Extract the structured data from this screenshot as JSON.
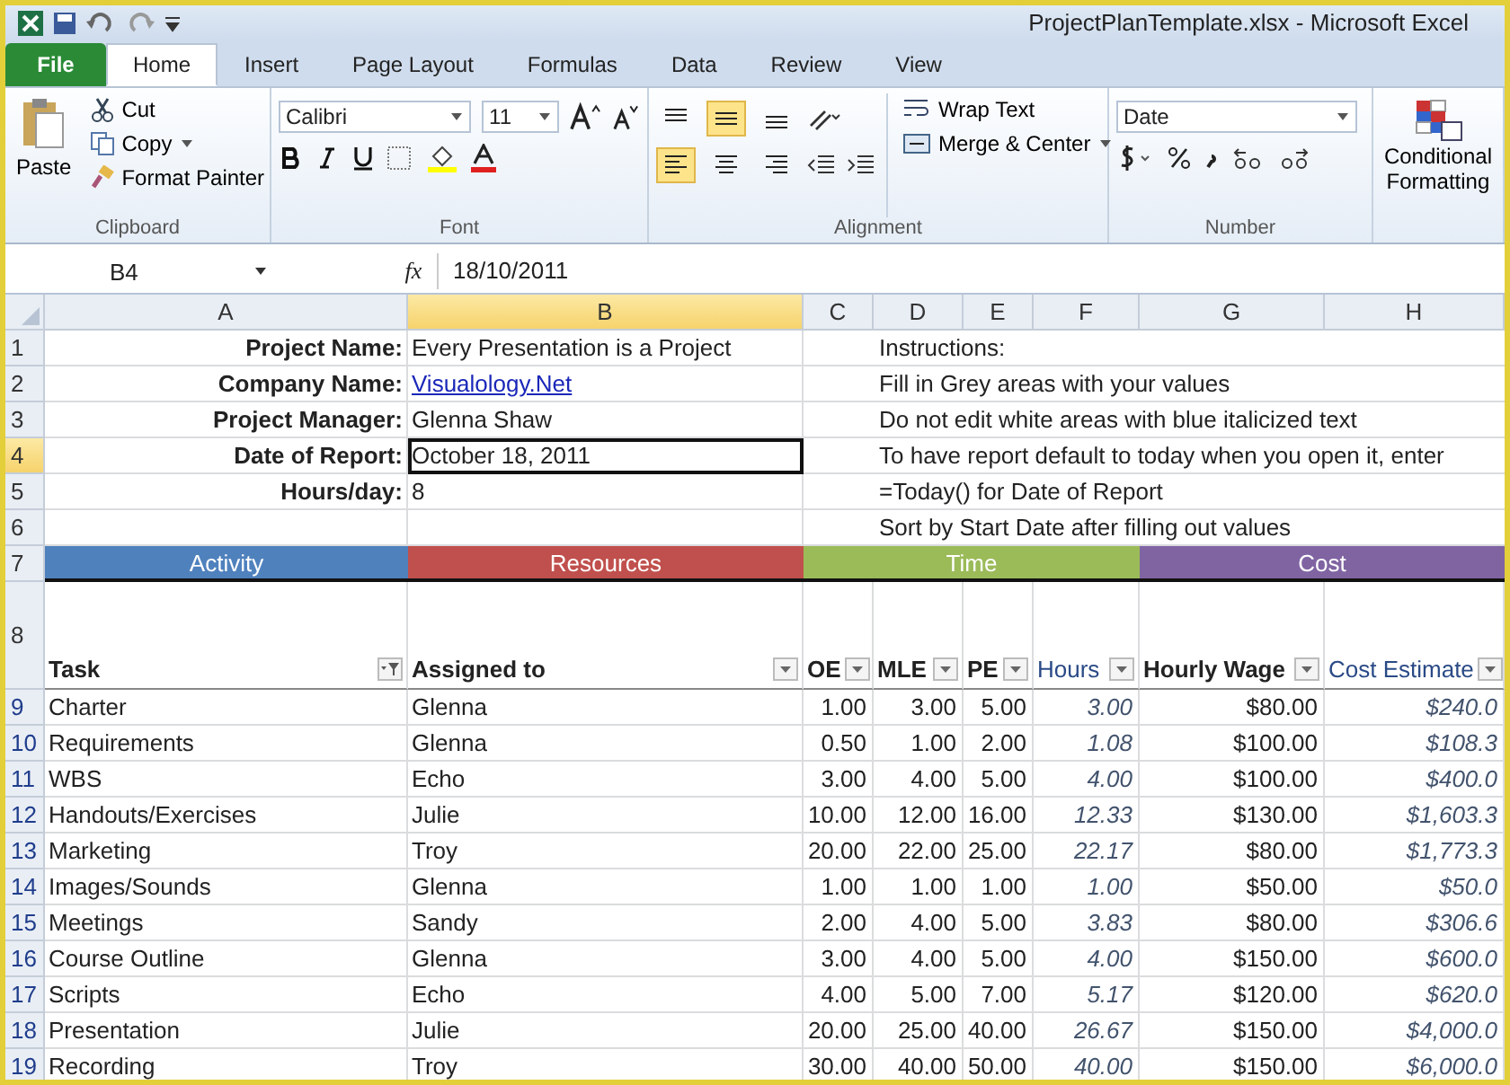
{
  "window": {
    "title": "ProjectPlanTemplate.xlsx  -  Microsoft Excel"
  },
  "tabs": [
    {
      "label": "File",
      "kind": "file",
      "selected": false
    },
    {
      "label": "Home",
      "kind": "tab",
      "selected": true
    },
    {
      "label": "Insert",
      "kind": "tab",
      "selected": false
    },
    {
      "label": "Page Layout",
      "kind": "tab",
      "selected": false
    },
    {
      "label": "Formulas",
      "kind": "tab",
      "selected": false
    },
    {
      "label": "Data",
      "kind": "tab",
      "selected": false
    },
    {
      "label": "Review",
      "kind": "tab",
      "selected": false
    },
    {
      "label": "View",
      "kind": "tab",
      "selected": false
    }
  ],
  "ribbon": {
    "clipboard": {
      "paste": "Paste",
      "cut": "Cut",
      "copy": "Copy",
      "format_painter": "Format Painter",
      "label": "Clipboard"
    },
    "font": {
      "name": "Calibri",
      "size": "11",
      "label": "Font"
    },
    "alignment": {
      "vertical": [
        {
          "kind": "top",
          "selected": false
        },
        {
          "kind": "middle",
          "selected": true
        },
        {
          "kind": "bottom",
          "selected": false
        }
      ],
      "horizontal": [
        {
          "kind": "left",
          "selected": true
        },
        {
          "kind": "center",
          "selected": false
        },
        {
          "kind": "right",
          "selected": false
        }
      ],
      "wrap_text": "Wrap Text",
      "merge_center": "Merge & Center",
      "label": "Alignment"
    },
    "number": {
      "format": "Date",
      "label": "Number"
    },
    "conditional_formatting": "Conditional Formatting"
  },
  "formula_bar": {
    "name_box": "B4",
    "function_label": "fx",
    "formula": "18/10/2011"
  },
  "columns": [
    {
      "label": "A",
      "selected": false
    },
    {
      "label": "B",
      "selected": true
    },
    {
      "label": "C",
      "selected": false
    },
    {
      "label": "D",
      "selected": false
    },
    {
      "label": "E",
      "selected": false
    },
    {
      "label": "F",
      "selected": false
    },
    {
      "label": "G",
      "selected": false
    },
    {
      "label": "H",
      "selected": false
    }
  ],
  "info_rows": [
    {
      "row": "1",
      "label": "Project Name:",
      "value": "Every Presentation is a Project",
      "kind": "text",
      "selected": false
    },
    {
      "row": "2",
      "label": "Company Name:",
      "value": "Visualology.Net",
      "kind": "link",
      "selected": false
    },
    {
      "row": "3",
      "label": "Project Manager:",
      "value": "Glenna Shaw",
      "kind": "text",
      "selected": false
    },
    {
      "row": "4",
      "label": "Date of Report:",
      "value": "October 18, 2011",
      "kind": "text",
      "selected": true
    },
    {
      "row": "5",
      "label": "Hours/day:",
      "value": "8",
      "kind": "text",
      "selected": false
    }
  ],
  "blank_row": "6",
  "instructions": [
    "Instructions:",
    "Fill in Grey areas with your values",
    "Do not edit white areas with blue italicized text",
    "To have report default to today when you open it, enter",
    "=Today() for Date of Report",
    "Sort by Start Date after filling out values"
  ],
  "band_row": "7",
  "bands": [
    {
      "label": "Activity",
      "color": "#4f81bd"
    },
    {
      "label": "Resources",
      "color": "#c0504d"
    },
    {
      "label": "Time",
      "color": "#9bbb59"
    },
    {
      "label": "Cost",
      "color": "#8064a2"
    }
  ],
  "header_row": "8",
  "table_columns": [
    {
      "label": "Task",
      "computed": false,
      "filtered": true
    },
    {
      "label": "Assigned to",
      "computed": false,
      "filtered": false
    },
    {
      "label": "OE",
      "computed": false,
      "filtered": false
    },
    {
      "label": "MLE",
      "computed": false,
      "filtered": false
    },
    {
      "label": "PE",
      "computed": false,
      "filtered": false
    },
    {
      "label": "Hours",
      "computed": true,
      "filtered": false
    },
    {
      "label": "Hourly Wage",
      "computed": false,
      "filtered": false
    },
    {
      "label": "Cost Estimate",
      "computed": true,
      "filtered": false
    }
  ],
  "rows": [
    {
      "row": "9",
      "cells": [
        "Charter",
        "Glenna",
        "1.00",
        "3.00",
        "5.00",
        "3.00",
        "$80.00",
        "$240.0"
      ]
    },
    {
      "row": "10",
      "cells": [
        "Requirements",
        "Glenna",
        "0.50",
        "1.00",
        "2.00",
        "1.08",
        "$100.00",
        "$108.3"
      ]
    },
    {
      "row": "11",
      "cells": [
        "WBS",
        "Echo",
        "3.00",
        "4.00",
        "5.00",
        "4.00",
        "$100.00",
        "$400.0"
      ]
    },
    {
      "row": "12",
      "cells": [
        "Handouts/Exercises",
        "Julie",
        "10.00",
        "12.00",
        "16.00",
        "12.33",
        "$130.00",
        "$1,603.3"
      ]
    },
    {
      "row": "13",
      "cells": [
        "Marketing",
        "Troy",
        "20.00",
        "22.00",
        "25.00",
        "22.17",
        "$80.00",
        "$1,773.3"
      ]
    },
    {
      "row": "14",
      "cells": [
        "Images/Sounds",
        "Glenna",
        "1.00",
        "1.00",
        "1.00",
        "1.00",
        "$50.00",
        "$50.0"
      ]
    },
    {
      "row": "15",
      "cells": [
        "Meetings",
        "Sandy",
        "2.00",
        "4.00",
        "5.00",
        "3.83",
        "$80.00",
        "$306.6"
      ]
    },
    {
      "row": "16",
      "cells": [
        "Course Outline",
        "Glenna",
        "3.00",
        "4.00",
        "5.00",
        "4.00",
        "$150.00",
        "$600.0"
      ]
    },
    {
      "row": "17",
      "cells": [
        "Scripts",
        "Echo",
        "4.00",
        "5.00",
        "7.00",
        "5.17",
        "$120.00",
        "$620.0"
      ]
    },
    {
      "row": "18",
      "cells": [
        "Presentation",
        "Julie",
        "20.00",
        "25.00",
        "40.00",
        "26.67",
        "$150.00",
        "$4,000.0"
      ]
    },
    {
      "row": "19",
      "cells": [
        "Recording",
        "Troy",
        "30.00",
        "40.00",
        "50.00",
        "40.00",
        "$150.00",
        "$6,000.0"
      ]
    }
  ]
}
